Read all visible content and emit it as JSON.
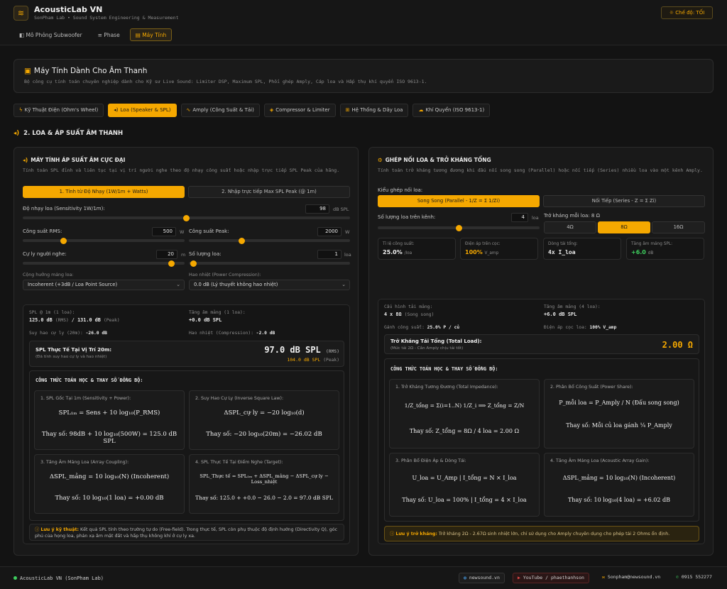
{
  "app": {
    "title": "AcousticLab VN",
    "subtitle": "SonPham Lab • Sound System Engineering & Measurement",
    "mode_label": "Chế độ: TỐI"
  },
  "nav": [
    "Mô Phỏng Subwoofer",
    "Phase",
    "Máy Tính"
  ],
  "hero": {
    "title": "Máy Tính Dành Cho Âm Thanh",
    "desc": "Bộ công cụ tính toán chuyên nghiệp dành cho Kỹ sư Live Sound: Limiter DSP, Maximum SPL, Phối ghép Amply, Cáp loa và Hấp thụ khí quyển ISO 9613-1."
  },
  "tabs": [
    "Kỹ Thuật Điện (Ohm's Wheel)",
    "Loa (Speaker & SPL)",
    "Amply (Công Suất & Tải)",
    "Compressor & Limiter",
    "Hệ Thống & Dây Loa",
    "Khí Quyển (ISO 9613-1)"
  ],
  "section_title": "2. LOA & ÁP SUẤT ÂM THANH",
  "left": {
    "title": "MÁY TÍNH ÁP SUẤT ÂM CỰC ĐẠI",
    "desc": "Tính toán SPL đỉnh và liên tục tại vị trí người nghe theo độ nhạy công suất hoặc nhập trực tiếp SPL Peak của hãng.",
    "mode1": "1. Tính từ Độ Nhạy (1W/1m + Watts)",
    "mode2": "2. Nhập trực tiếp Max SPL Peak (@ 1m)",
    "sens_label": "Độ nhạy loa (Sensitivity 1W/1m):",
    "sens_value": "98",
    "sens_unit": "dB SPL",
    "sens_level": 0.5,
    "rms_label": "Công suất RMS:",
    "rms_value": "500",
    "rms_unit": "W",
    "rms_level": 0.25,
    "peak_label": "Công suất Peak:",
    "peak_value": "2000",
    "peak_unit": "W",
    "peak_level": 0.33,
    "dist_label": "Cự ly người nghe:",
    "dist_value": "20",
    "dist_unit": "m",
    "dist_level": 0.92,
    "count_label": "Số lượng loa:",
    "count_value": "1",
    "count_unit": "loa",
    "count_level": 0.03,
    "coupling_label": "Cộng hưởng mảng loa:",
    "coupling_value": "Incoherent (+3dB / Loa Point Source)",
    "compression_label": "Hao nhiệt (Power Compression):",
    "compression_value": "0.0 dB (Lý thuyết không hao nhiệt)",
    "r_spl_label": "SPL @ 1m (1 loa):",
    "r_spl_value": "125.0 dB",
    "r_spl_rms": "(RMS)",
    "r_spl_sep": "/",
    "r_spl_peak": "131.0 dB",
    "r_spl_peak_tag": "(Peak)",
    "r_gain_label": "Tăng âm mảng (1 loa):",
    "r_gain_value": "+0.0 dB SPL",
    "r_loss_label": "Suy hao cự ly (20m):",
    "r_loss_value": "-26.0 dB",
    "r_comp_label": "Hao nhiệt (Compression):",
    "r_comp_value": "-2.0 dB",
    "final_title": "SPL Thực Tế Tại Vị Trí 20m:",
    "final_sub": "(Đã tính suy hao cự ly và hao nhiệt)",
    "final_value": "97.0 dB SPL",
    "final_rms": "(RMS)",
    "final_peak": "104.0 dB SPL",
    "final_peak_tag": "(Peak)",
    "formula_title": "CÔNG THỨC TOÁN HỌC & THAY SỐ ĐỒNG BỘ:",
    "c1_title": "1. SPL Gốc Tại 1m (Sensitivity + Power):",
    "c1_f": "SPL₁ₘ = Sens + 10 log₁₀(P_RMS)",
    "c1_s": "Thay số: 98dB + 10 log₁₀(500W) = 125.0 dB SPL",
    "c2_title": "2. Suy Hao Cự Ly (Inverse Square Law):",
    "c2_f": "ΔSPL_cự ly = −20 log₁₀(d)",
    "c2_s": "Thay số: −20 log₁₀(20m) = −26.02 dB",
    "c3_title": "3. Tăng Âm Mảng Loa (Array Coupling):",
    "c3_f": "ΔSPL_mảng = 10 log₁₀(N)   (Incoherent)",
    "c3_s": "Thay số: 10 log₁₀(1 loa) = +0.00 dB",
    "c4_title": "4. SPL Thực Tế Tại Điểm Nghe (Target):",
    "c4_f": "SPL_Thực tế = SPL₁ₘ + ΔSPL_mảng − ΔSPL_cự ly − Loss_nhiệt",
    "c4_s": "Thay số: 125.0 + +0.0 − 26.0 − 2.0 = 97.0 dB SPL",
    "note_label": "Lưu ý kỹ thuật:",
    "note_text": "Kết quả SPL tính theo trường tự do (Free-field). Trong thực tế, SPL còn phụ thuộc độ định hướng (Directivity Q), góc phủ của họng loa, phản xạ âm mặt đất và hấp thụ không khí ở cự ly xa."
  },
  "right": {
    "title": "GHÉP NỐI LOA & TRỞ KHÁNG TỔNG",
    "desc": "Tính toán trở kháng tương đương khi đấu nối song song (Parallel) hoặc nối tiếp (Series) nhiều loa vào một kênh Amply.",
    "type_label": "Kiểu ghép nối loa:",
    "type1": "Song Song (Parallel - 1/Z = Σ 1/Zi)",
    "type2": "Nối Tiếp (Series - Z = Σ Zi)",
    "count_label": "Số lượng loa trên kênh:",
    "count_value": "4",
    "count_unit": "loa",
    "count_level": 0.5,
    "imp_label": "Trở kháng mỗi loa: 8 Ω",
    "imp_options": [
      "4Ω",
      "8Ω",
      "16Ω"
    ],
    "stats": [
      {
        "label": "Tỉ lệ công suất:",
        "value": "25.0%",
        "unit": "/loa"
      },
      {
        "label": "Điện áp trên cọc:",
        "value": "100%",
        "unit": "V_amp"
      },
      {
        "label": "Dòng tải tổng:",
        "value": "4x I_loa",
        "unit": ""
      },
      {
        "label": "Tăng âm mảng SPL:",
        "value": "+6.0",
        "unit": "dB"
      }
    ],
    "cfg_label": "Cấu hình tải mảng:",
    "cfg_value": "4 x 8Ω",
    "cfg_tag": "(Song song)",
    "gain_label": "Tăng âm mảng (4 loa):",
    "gain_value": "+6.0 dB SPL",
    "power_label": "Gánh công suất:",
    "power_value": "25.0% P / củ",
    "volt_label": "Điện áp cọc loa:",
    "volt_value": "100% V_amp",
    "total_title": "Trở Kháng Tải Tổng (Total Load):",
    "total_sub": "(Mức tải 2Ω - Cần Amply chịu tải tốt)",
    "total_value": "2.00 Ω",
    "formula_title": "CÔNG THỨC TOÁN HỌC & THAY SỐ ĐỒNG BỘ:",
    "c1_title": "1. Trở Kháng Tương Đương (Total Impedance):",
    "c1_f": "1/Z_tổng = Σ(i=1..N) 1/Z_i  ⟹  Z_tổng = Z/N",
    "c1_s": "Thay số: Z_tổng = 8Ω / 4 loa = 2.00 Ω",
    "c2_title": "2. Phân Bổ Công Suất (Power Share):",
    "c2_f": "P_mỗi loa = P_Amply / N   (Đấu song song)",
    "c2_s": "Thay số: Mỗi củ loa gánh ¼ P_Amply",
    "c3_title": "3. Phân Bổ Điện Áp & Dòng Tải:",
    "c3_f": "U_loa = U_Amp | I_tổng = N × I_loa",
    "c3_s": "Thay số: U_loa = 100% | I_tổng = 4 × I_loa",
    "c4_title": "4. Tăng Âm Mảng Loa (Acoustic Array Gain):",
    "c4_f": "ΔSPL_mảng = 10 log₁₀(N)   (Incoherent)",
    "c4_s": "Thay số: 10 log₁₀(4 loa) = +6.02 dB",
    "note_label": "Lưu ý trở kháng:",
    "note_text": "Trở kháng 2Ω - 2.67Ω sinh nhiệt lớn, chỉ sử dụng cho Amply chuyên dụng cho phép tải 2 Ohms ổn định."
  },
  "footer": {
    "brand": "AcousticLab VN (SonPham Lab)",
    "site": "newsound.vn",
    "youtube": "YouTube / phaethanhson",
    "email": "Sonpham@newsound.vn",
    "phone": "0915 552277"
  }
}
